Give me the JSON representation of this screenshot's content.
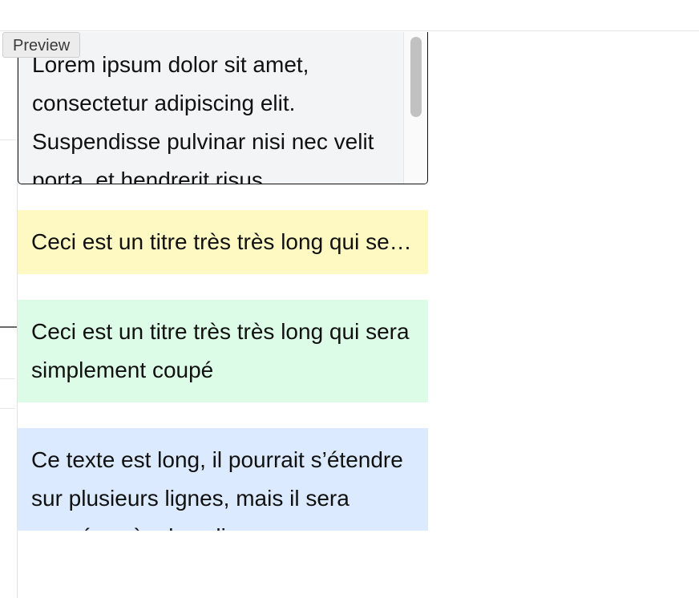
{
  "preview_tab": {
    "label": "Preview"
  },
  "blocks": {
    "scroll": {
      "text": "Lorem ipsum dolor sit amet, consectetur adipiscing elit. Suspendisse pulvinar nisi nec velit porta, et hendrerit risus"
    },
    "ellipsis": {
      "text": "Ceci est un titre très très long qui sera tronqué"
    },
    "clipped": {
      "text": "Ceci est un titre très très long qui sera simplement coupé"
    },
    "clamped": {
      "text": "Ce texte est long, il pourrait s’étendre sur plusieurs lignes, mais il sera coupé après deux lignes"
    }
  },
  "colors": {
    "scroll_bg": "#f3f4f6",
    "ellipsis_bg": "#fef9c3",
    "clipped_bg": "#dcfce7",
    "clamped_bg": "#dbeafe"
  }
}
